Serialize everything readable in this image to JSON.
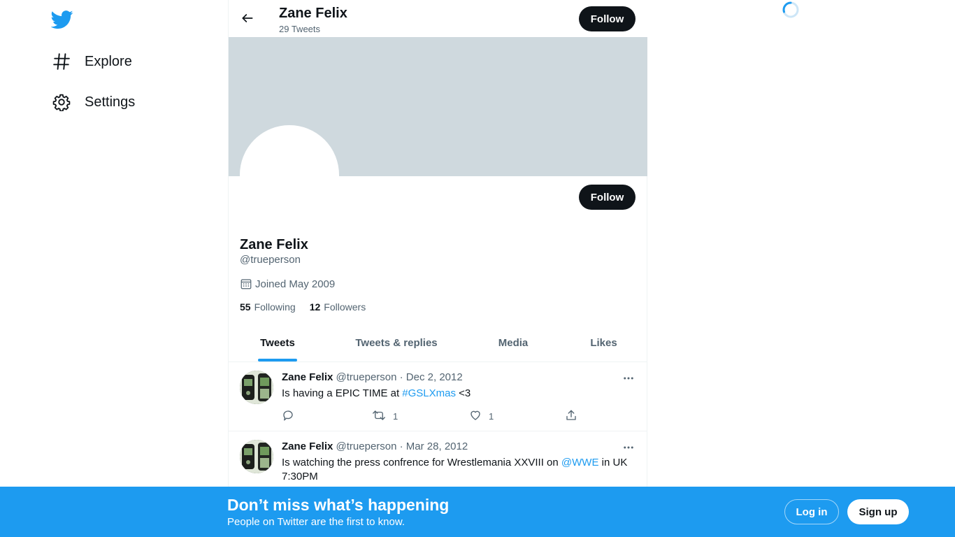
{
  "nav": {
    "items": [
      {
        "label": "Explore",
        "icon": "hashtag-icon"
      },
      {
        "label": "Settings",
        "icon": "gear-icon"
      }
    ]
  },
  "header": {
    "name": "Zane Felix",
    "tweet_count": "29 Tweets",
    "follow_label": "Follow"
  },
  "profile": {
    "name": "Zane Felix",
    "handle": "@trueperson",
    "joined": "Joined May 2009",
    "following_count": "55",
    "following_label": "Following",
    "followers_count": "12",
    "followers_label": "Followers",
    "follow_label": "Follow"
  },
  "tabs": [
    {
      "label": "Tweets",
      "active": true
    },
    {
      "label": "Tweets & replies",
      "active": false
    },
    {
      "label": "Media",
      "active": false
    },
    {
      "label": "Likes",
      "active": false
    }
  ],
  "tweets": [
    {
      "name": "Zane Felix",
      "handle_date": "@trueperson · Dec 2, 2012",
      "text_parts": [
        "Is having a EPIC TIME at ",
        "#GSLXmas",
        " <3"
      ],
      "retweets": "1",
      "likes": "1"
    },
    {
      "name": "Zane Felix",
      "handle_date": "@trueperson · Mar 28, 2012",
      "text_parts": [
        "Is watching the press confrence for Wrestlemania XXVIII on ",
        "@WWE",
        " in UK 7:30PM"
      ]
    }
  ],
  "bottom_bar": {
    "title": "Don’t miss what’s happening",
    "subtitle": "People on Twitter are the first to know.",
    "login_label": "Log in",
    "signup_label": "Sign up"
  },
  "colors": {
    "accent": "#1d9bf0",
    "banner": "#cfd9de",
    "text": "#0f1419",
    "muted": "#536471"
  }
}
